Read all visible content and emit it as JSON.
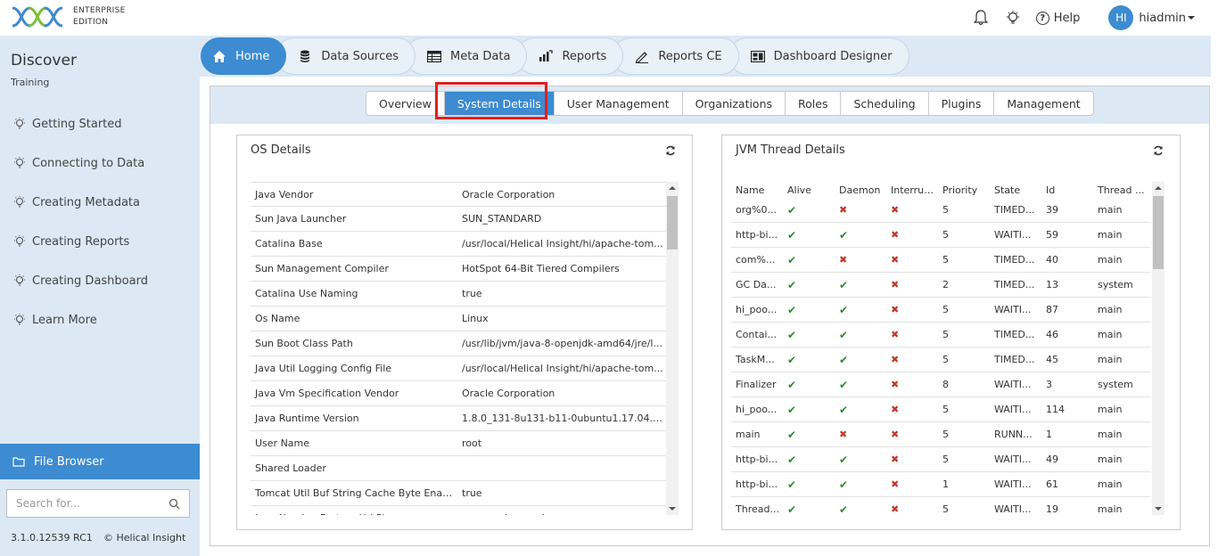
{
  "brand": {
    "line1": "ENTERPRISE",
    "line2": "EDITION",
    "accent": "#3d8bd1"
  },
  "header": {
    "help_label": "Help",
    "avatar_initials": "HI",
    "username": "hiadmin"
  },
  "sidebar": {
    "title": "Discover",
    "subtitle": "Training",
    "items": [
      {
        "label": "Getting Started"
      },
      {
        "label": "Connecting to Data"
      },
      {
        "label": "Creating Metadata"
      },
      {
        "label": "Creating Reports"
      },
      {
        "label": "Creating Dashboard"
      },
      {
        "label": "Learn More"
      }
    ],
    "file_browser_label": "File Browser",
    "search_placeholder": "Search for...",
    "version": "3.1.0.12539 RC1",
    "copyright": "© Helical Insight"
  },
  "main_tabs": [
    {
      "label": "Home",
      "icon": "home-icon"
    },
    {
      "label": "Data Sources",
      "icon": "database-icon"
    },
    {
      "label": "Meta Data",
      "icon": "table-icon"
    },
    {
      "label": "Reports",
      "icon": "bar-chart-icon"
    },
    {
      "label": "Reports CE",
      "icon": "pen-icon"
    },
    {
      "label": "Dashboard Designer",
      "icon": "dashboard-icon"
    }
  ],
  "sub_tabs": [
    {
      "label": "Overview"
    },
    {
      "label": "System Details"
    },
    {
      "label": "User Management"
    },
    {
      "label": "Organizations"
    },
    {
      "label": "Roles"
    },
    {
      "label": "Scheduling"
    },
    {
      "label": "Plugins"
    },
    {
      "label": "Management"
    }
  ],
  "os_panel": {
    "title": "OS Details",
    "rows": [
      {
        "key": "Java Vendor",
        "value": "Oracle Corporation"
      },
      {
        "key": "Sun Java Launcher",
        "value": "SUN_STANDARD"
      },
      {
        "key": "Catalina Base",
        "value": "/usr/local/Helical Insight/hi/apache-tom..."
      },
      {
        "key": "Sun Management Compiler",
        "value": "HotSpot 64-Bit Tiered Compilers"
      },
      {
        "key": "Catalina Use Naming",
        "value": "true"
      },
      {
        "key": "Os Name",
        "value": "Linux"
      },
      {
        "key": "Sun Boot Class Path",
        "value": "/usr/lib/jvm/java-8-openjdk-amd64/jre/l..."
      },
      {
        "key": "Java Util Logging Config File",
        "value": "/usr/local/Helical Insight/hi/apache-tom..."
      },
      {
        "key": "Java Vm Specification Vendor",
        "value": "Oracle Corporation"
      },
      {
        "key": "Java Runtime Version",
        "value": "1.8.0_131-8u131-b11-0ubuntu1.17.04.1..."
      },
      {
        "key": "User Name",
        "value": "root"
      },
      {
        "key": "Shared Loader",
        "value": ""
      },
      {
        "key": "Tomcat Util Buf String Cache Byte Enab...",
        "value": "true"
      },
      {
        "key": "Java Naming Factory Url Pkgs",
        "value": "org.apache.naming"
      }
    ]
  },
  "jvm_panel": {
    "title": "JVM Thread Details",
    "columns": [
      "Name",
      "Alive",
      "Daemon",
      "Interrupt...",
      "Priority",
      "State",
      "Id",
      "Thread ..."
    ],
    "rows": [
      {
        "name": "org%0...",
        "alive": true,
        "daemon": false,
        "interrupted": false,
        "priority": "5",
        "state": "TIMED...",
        "id": "39",
        "group": "main"
      },
      {
        "name": "http-bi...",
        "alive": true,
        "daemon": true,
        "interrupted": false,
        "priority": "5",
        "state": "WAITI...",
        "id": "59",
        "group": "main"
      },
      {
        "name": "com%...",
        "alive": true,
        "daemon": false,
        "interrupted": false,
        "priority": "5",
        "state": "TIMED...",
        "id": "40",
        "group": "main"
      },
      {
        "name": "GC Da...",
        "alive": true,
        "daemon": true,
        "interrupted": false,
        "priority": "2",
        "state": "TIMED...",
        "id": "13",
        "group": "system"
      },
      {
        "name": "hi_poo...",
        "alive": true,
        "daemon": true,
        "interrupted": false,
        "priority": "5",
        "state": "WAITI...",
        "id": "87",
        "group": "main"
      },
      {
        "name": "Contai...",
        "alive": true,
        "daemon": true,
        "interrupted": false,
        "priority": "5",
        "state": "TIMED...",
        "id": "46",
        "group": "main"
      },
      {
        "name": "TaskM...",
        "alive": true,
        "daemon": true,
        "interrupted": false,
        "priority": "5",
        "state": "TIMED...",
        "id": "45",
        "group": "main"
      },
      {
        "name": "Finalizer",
        "alive": true,
        "daemon": true,
        "interrupted": false,
        "priority": "8",
        "state": "WAITI...",
        "id": "3",
        "group": "system"
      },
      {
        "name": "hi_poo...",
        "alive": true,
        "daemon": true,
        "interrupted": false,
        "priority": "5",
        "state": "WAITI...",
        "id": "114",
        "group": "main"
      },
      {
        "name": "main",
        "alive": true,
        "daemon": false,
        "interrupted": false,
        "priority": "5",
        "state": "RUNN...",
        "id": "1",
        "group": "main"
      },
      {
        "name": "http-bi...",
        "alive": true,
        "daemon": true,
        "interrupted": false,
        "priority": "5",
        "state": "WAITI...",
        "id": "49",
        "group": "main"
      },
      {
        "name": "http-bi...",
        "alive": true,
        "daemon": true,
        "interrupted": false,
        "priority": "1",
        "state": "WAITI...",
        "id": "61",
        "group": "main"
      },
      {
        "name": "Thread...",
        "alive": true,
        "daemon": true,
        "interrupted": false,
        "priority": "5",
        "state": "WAITI...",
        "id": "19",
        "group": "main"
      }
    ]
  }
}
